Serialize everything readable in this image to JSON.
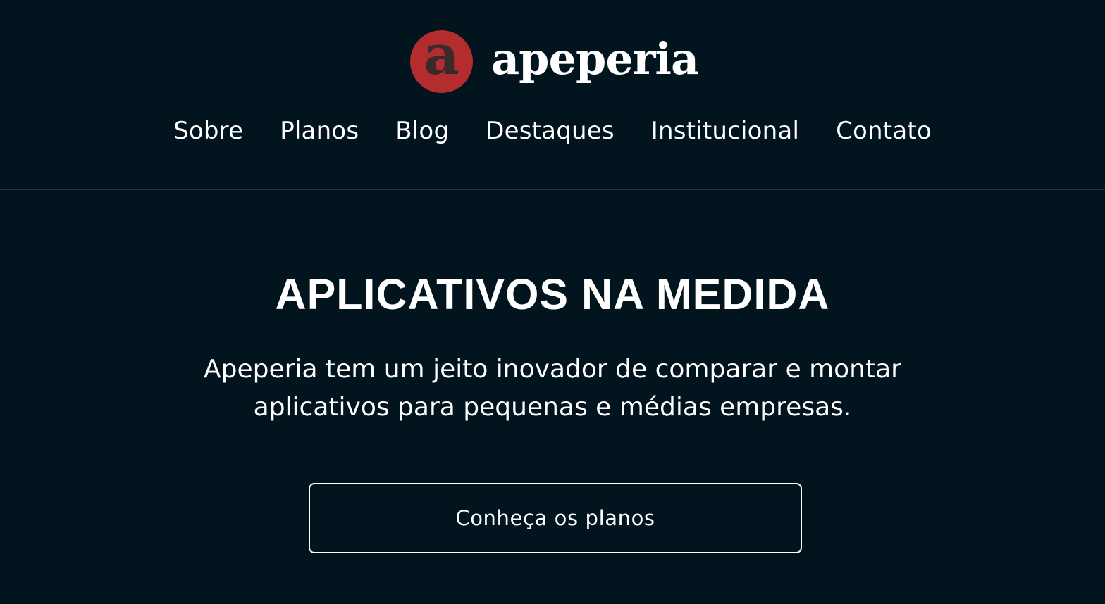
{
  "brand": {
    "logo_letter": "a",
    "name": "apeperia",
    "accent_color": "#b32d2e",
    "background_color": "#02141d"
  },
  "nav": {
    "items": [
      {
        "label": "Sobre"
      },
      {
        "label": "Planos"
      },
      {
        "label": "Blog"
      },
      {
        "label": "Destaques"
      },
      {
        "label": "Institucional"
      },
      {
        "label": "Contato"
      }
    ]
  },
  "hero": {
    "title": "APLICATIVOS NA MEDIDA",
    "text": "Apeperia tem um jeito inovador de comparar e montar aplicativos para pequenas e médias empresas.",
    "cta_label": "Conheça os planos"
  }
}
